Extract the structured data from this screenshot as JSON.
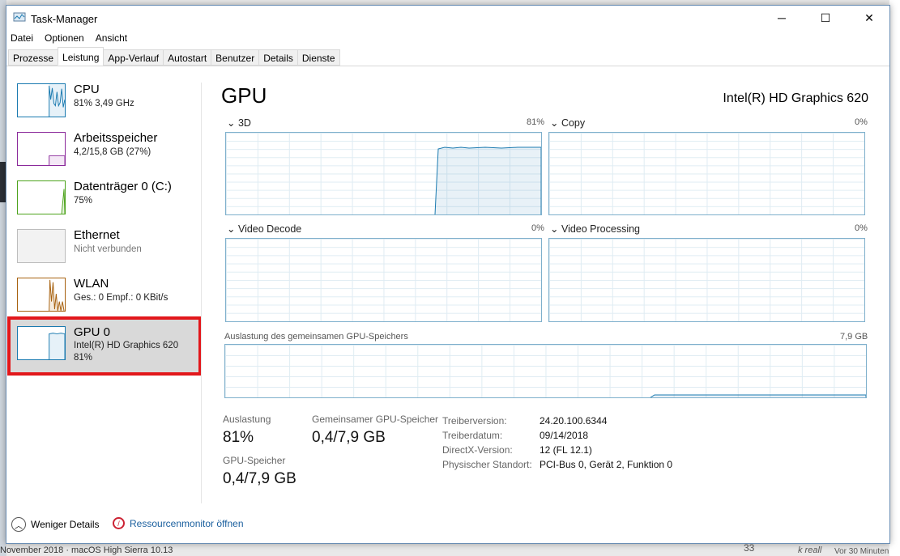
{
  "window": {
    "title": "Task-Manager",
    "minimize": "─",
    "maximize": "☐",
    "close": "✕"
  },
  "menu": [
    "Datei",
    "Optionen",
    "Ansicht"
  ],
  "tabs": [
    "Prozesse",
    "Leistung",
    "App-Verlauf",
    "Autostart",
    "Benutzer",
    "Details",
    "Dienste"
  ],
  "sidebar": [
    {
      "name": "CPU",
      "sub": "81% 3,49 GHz",
      "color": "#1a7ab0"
    },
    {
      "name": "Arbeitsspeicher",
      "sub": "4,2/15,8 GB (27%)",
      "color": "#8b2a9b"
    },
    {
      "name": "Datenträger 0 (C:)",
      "sub": "75%",
      "color": "#4da31c"
    },
    {
      "name": "Ethernet",
      "sub": "Nicht verbunden",
      "color": "#bdbdbd"
    },
    {
      "name": "WLAN",
      "sub": "Ges.: 0 Empf.: 0 KBit/s",
      "color": "#a7610f"
    },
    {
      "name": "GPU 0",
      "sub": "Intel(R) HD Graphics 620",
      "sub2": "81%",
      "color": "#1a7ab0"
    }
  ],
  "main": {
    "title": "GPU",
    "model": "Intel(R) HD Graphics 620",
    "graphs": [
      {
        "label": "3D",
        "value": "81%"
      },
      {
        "label": "Copy",
        "value": "0%"
      },
      {
        "label": "Video Decode",
        "value": "0%"
      },
      {
        "label": "Video Processing",
        "value": "0%"
      }
    ],
    "shared": {
      "label": "Auslastung des gemeinsamen GPU-Speichers",
      "value": "7,9 GB"
    },
    "stats": {
      "util_label": "Auslastung",
      "util": "81%",
      "shared_label": "Gemeinsamer GPU-Speicher",
      "shared": "0,4/7,9 GB",
      "mem_label": "GPU-Speicher",
      "mem": "0,4/7,9 GB"
    },
    "details": [
      {
        "k": "Treiberversion:",
        "v": "24.20.100.6344"
      },
      {
        "k": "Treiberdatum:",
        "v": "09/14/2018"
      },
      {
        "k": "DirectX-Version:",
        "v": "12 (FL 12.1)"
      },
      {
        "k": "Physischer Standort:",
        "v": "PCI-Bus 0, Gerät 2, Funktion 0"
      }
    ]
  },
  "footer": {
    "less": "Weniger Details",
    "monitor": "Ressourcenmonitor öffnen"
  },
  "background": {
    "bottom_left": "November 2018 · macOS High Sierra 10.13",
    "comments": "33",
    "author": "k reall",
    "time": "Vor 30 Minuten"
  }
}
